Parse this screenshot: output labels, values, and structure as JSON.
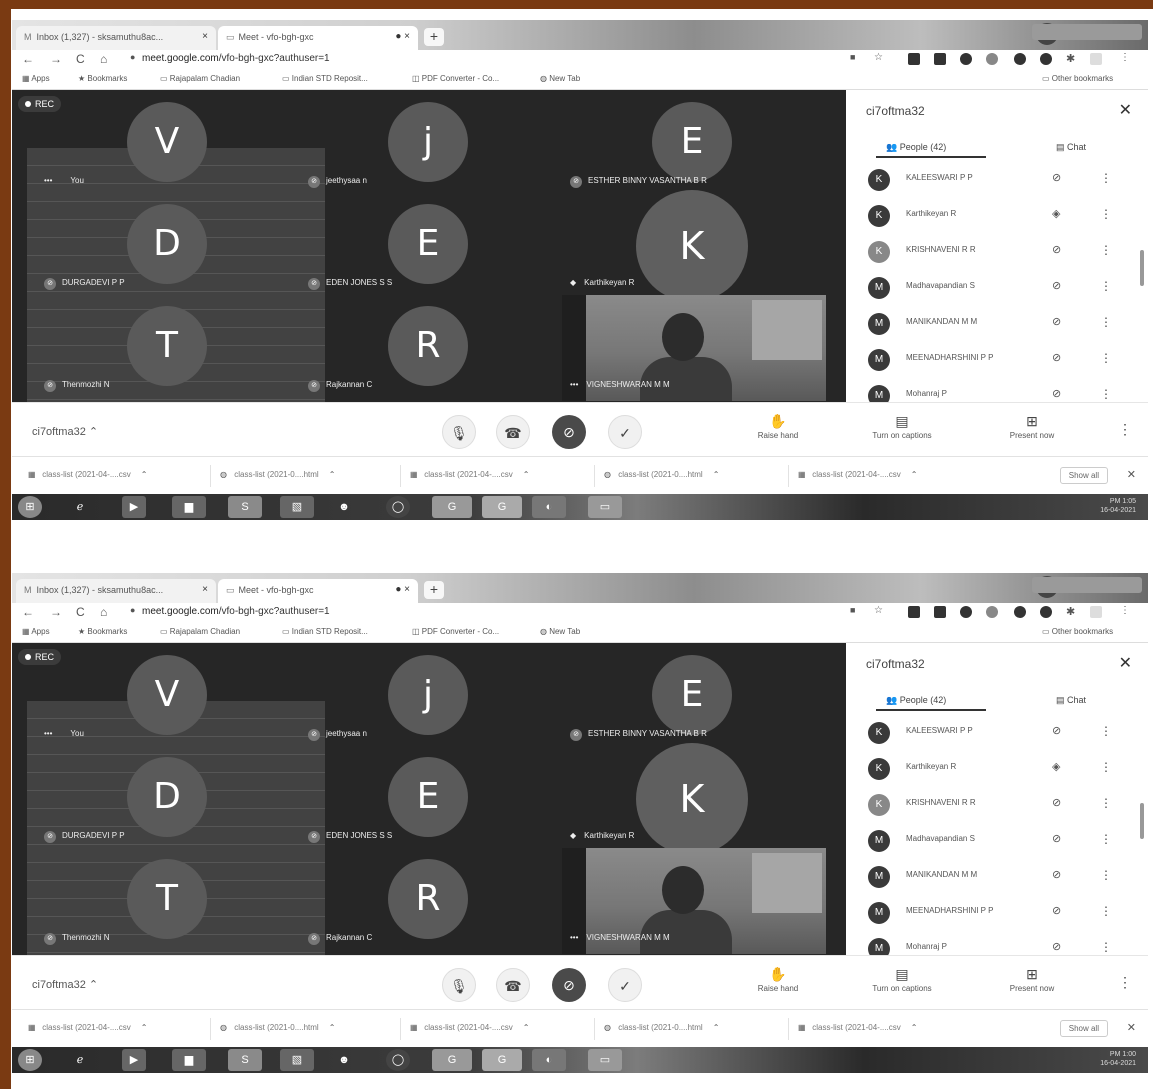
{
  "screens": [
    {
      "browser": {
        "tabs": [
          {
            "label": "Inbox (1,327) - sksamuthu8ac..."
          },
          {
            "label": "Meet - vfo-bgh-gxc"
          }
        ],
        "url_host": "meet.google.com",
        "url_path": "/vfo-bgh-gxc?authuser=1",
        "bookmarks": [
          "Apps",
          "Bookmarks",
          "Rajapalam Chadian",
          "Indian STD Reposit...",
          "PDF Converter - Co...",
          "New Tab",
          "Other bookmarks"
        ]
      },
      "meet": {
        "rec_label": "REC",
        "tiles": [
          {
            "initial": "V",
            "name": "You"
          },
          {
            "initial": "j",
            "name": "jeethysaa n"
          },
          {
            "initial": "E",
            "name": "ESTHER BINNY VASANTHA B R"
          },
          {
            "initial": "D",
            "name": "DURGADEVI P P"
          },
          {
            "initial": "E",
            "name": "EDEN JONES S S"
          },
          {
            "initial": "K",
            "name": "Karthikeyan R"
          },
          {
            "initial": "T",
            "name": "Thenmozhi N"
          },
          {
            "initial": "R",
            "name": "Rajkannan C"
          }
        ],
        "video_name": "VIGNESHWARAN M M"
      },
      "panel": {
        "title": "ci7oftma32",
        "tab_people": "People (42)",
        "tab_chat": "Chat",
        "people": [
          {
            "initial": "K",
            "name": "KALEESWARI P P"
          },
          {
            "initial": "K",
            "name": "Karthikeyan R"
          },
          {
            "initial": "K",
            "name": "KRISHNAVENI R R"
          },
          {
            "initial": "M",
            "name": "Madhavapandian S"
          },
          {
            "initial": "M",
            "name": "MANIKANDAN M M"
          },
          {
            "initial": "M",
            "name": "MEENADHARSHINI P P"
          },
          {
            "initial": "M",
            "name": "Mohanraj P"
          }
        ]
      },
      "controls": {
        "meeting_code": "ci7oftma32",
        "raise_hand": "Raise hand",
        "captions": "Turn on captions",
        "present": "Present now"
      },
      "downloads": {
        "items": [
          "class-list (2021-04-....csv",
          "class-list (2021-0....html",
          "class-list (2021-04-....csv",
          "class-list (2021-0....html",
          "class-list (2021-04-....csv"
        ],
        "show_all": "Show all"
      },
      "clock": {
        "time": "PM 1:05",
        "date": "16-04-2021"
      }
    },
    {
      "browser": {
        "tabs": [
          {
            "label": "Inbox (1,327) - sksamuthu8ac..."
          },
          {
            "label": "Meet - vfo-bgh-gxc"
          }
        ],
        "url_host": "meet.google.com",
        "url_path": "/vfo-bgh-gxc?authuser=1",
        "bookmarks": [
          "Apps",
          "Bookmarks",
          "Rajapalam Chadian",
          "Indian STD Reposit...",
          "PDF Converter - Co...",
          "New Tab",
          "Other bookmarks"
        ]
      },
      "meet": {
        "rec_label": "REC",
        "tiles": [
          {
            "initial": "V",
            "name": "You"
          },
          {
            "initial": "j",
            "name": "jeethysaa n"
          },
          {
            "initial": "E",
            "name": "ESTHER BINNY VASANTHA B R"
          },
          {
            "initial": "D",
            "name": "DURGADEVI P P"
          },
          {
            "initial": "E",
            "name": "EDEN JONES S S"
          },
          {
            "initial": "K",
            "name": "Karthikeyan R"
          },
          {
            "initial": "T",
            "name": "Thenmozhi N"
          },
          {
            "initial": "R",
            "name": "Rajkannan C"
          }
        ],
        "video_name": "VIGNESHWARAN M M"
      },
      "panel": {
        "title": "ci7oftma32",
        "tab_people": "People (42)",
        "tab_chat": "Chat",
        "people": [
          {
            "initial": "K",
            "name": "KALEESWARI P P"
          },
          {
            "initial": "K",
            "name": "Karthikeyan R"
          },
          {
            "initial": "K",
            "name": "KRISHNAVENI R R"
          },
          {
            "initial": "M",
            "name": "Madhavapandian S"
          },
          {
            "initial": "M",
            "name": "MANIKANDAN M M"
          },
          {
            "initial": "M",
            "name": "MEENADHARSHINI P P"
          },
          {
            "initial": "M",
            "name": "Mohanraj P"
          }
        ]
      },
      "controls": {
        "meeting_code": "ci7oftma32",
        "raise_hand": "Raise hand",
        "captions": "Turn on captions",
        "present": "Present now"
      },
      "downloads": {
        "items": [
          "class-list (2021-04-....csv",
          "class-list (2021-0....html",
          "class-list (2021-04-....csv",
          "class-list (2021-0....html",
          "class-list (2021-04-....csv"
        ],
        "show_all": "Show all"
      },
      "clock": {
        "time": "PM 1:00",
        "date": "16-04-2021"
      }
    }
  ]
}
